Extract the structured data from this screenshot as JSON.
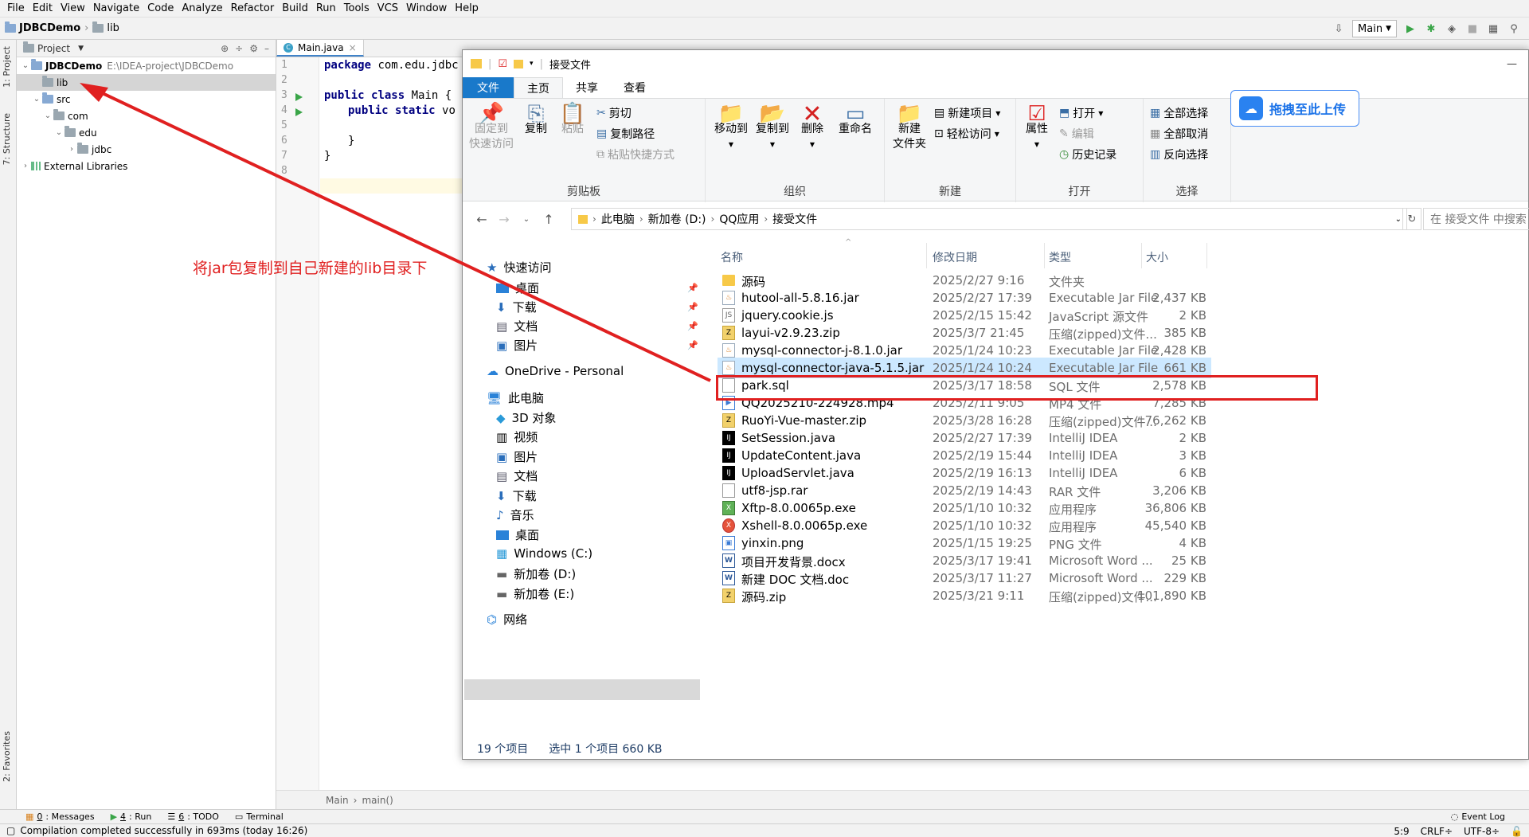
{
  "menu": [
    "File",
    "Edit",
    "View",
    "Navigate",
    "Code",
    "Analyze",
    "Refactor",
    "Build",
    "Run",
    "Tools",
    "VCS",
    "Window",
    "Help"
  ],
  "nav": {
    "project": "JDBCDemo",
    "folder": "lib",
    "run_config": "Main"
  },
  "left_strip": {
    "project": "1: Project",
    "structure": "7: Structure",
    "favorites": "2: Favorites"
  },
  "project_panel": {
    "title": "Project",
    "tree": [
      {
        "label": "JDBCDemo",
        "path": "E:\\IDEA-project\\JDBCDemo"
      },
      {
        "label": "lib"
      },
      {
        "label": "src"
      },
      {
        "label": "com"
      },
      {
        "label": "edu"
      },
      {
        "label": "jdbc"
      },
      {
        "label": "External Libraries"
      }
    ]
  },
  "editor": {
    "tab": "Main.java",
    "lines": [
      "1",
      "2",
      "3",
      "4",
      "5",
      "6",
      "7",
      "8"
    ],
    "code": {
      "l1_kw": "package",
      "l1_rest": " com.edu.jdbc",
      "l3_kw1": "public",
      "l3_kw2": "class",
      "l3_rest": " Main {",
      "l4_kw1": "public",
      "l4_kw2": "static",
      "l4_rest": " vo",
      "l6": "}",
      "l7": "}"
    },
    "crumb_main": "Main",
    "crumb_method": "main()"
  },
  "bottom_tools": [
    {
      "num": "0",
      "label": ": Messages"
    },
    {
      "num": "4",
      "label": ": Run"
    },
    {
      "num": "6",
      "label": ": TODO"
    },
    {
      "num": "",
      "label": "Terminal"
    }
  ],
  "event_log": "Event Log",
  "status": {
    "message": "Compilation completed successfully in 693ms (today 16:26)",
    "position": "5:9",
    "line_sep": "CRLF÷",
    "encoding": "UTF-8÷"
  },
  "explorer": {
    "title": "接受文件",
    "tabs": {
      "file": "文件",
      "home": "主页",
      "share": "共享",
      "view": "查看"
    },
    "ribbon": {
      "pin": "固定到\n快速访问",
      "copy": "复制",
      "paste": "粘贴",
      "cut": "剪切",
      "copy_path": "复制路径",
      "paste_shortcut": "粘贴快捷方式",
      "grp_clipboard": "剪贴板",
      "move_to": "移动到",
      "copy_to": "复制到",
      "delete": "删除",
      "rename": "重命名",
      "grp_organize": "组织",
      "new_folder": "新建\n文件夹",
      "new_item": "新建项目",
      "easy_access": "轻松访问",
      "grp_new": "新建",
      "properties": "属性",
      "open": "打开",
      "edit": "编辑",
      "history": "历史记录",
      "grp_open": "打开",
      "select_all": "全部选择",
      "select_none": "全部取消",
      "invert": "反向选择",
      "grp_select": "选择"
    },
    "upload_label": "拖拽至此上传",
    "address": [
      "此电脑",
      "新加卷 (D:)",
      "QQ应用",
      "接受文件"
    ],
    "search_placeholder": "在 接受文件 中搜索",
    "nav_pane": {
      "quick_access": "快速访问",
      "qa_items": [
        "桌面",
        "下载",
        "文档",
        "图片"
      ],
      "onedrive": "OneDrive - Personal",
      "this_pc": "此电脑",
      "pc_items": [
        "3D 对象",
        "视频",
        "图片",
        "文档",
        "下载",
        "音乐",
        "桌面",
        "Windows (C:)",
        "新加卷 (D:)",
        "新加卷 (E:)"
      ],
      "network": "网络"
    },
    "columns": {
      "name": "名称",
      "date": "修改日期",
      "type": "类型",
      "size": "大小"
    },
    "files": [
      {
        "name": "源码",
        "date": "2025/2/27 9:16",
        "type": "文件夹",
        "size": "",
        "icon": "folder"
      },
      {
        "name": "hutool-all-5.8.16.jar",
        "date": "2025/2/27 17:39",
        "type": "Executable Jar File",
        "size": "2,437 KB",
        "icon": "jar"
      },
      {
        "name": "jquery.cookie.js",
        "date": "2025/2/15 15:42",
        "type": "JavaScript 源文件",
        "size": "2 KB",
        "icon": "js"
      },
      {
        "name": "layui-v2.9.23.zip",
        "date": "2025/3/7 21:45",
        "type": "压缩(zipped)文件...",
        "size": "385 KB",
        "icon": "zip"
      },
      {
        "name": "mysql-connector-j-8.1.0.jar",
        "date": "2025/1/24 10:23",
        "type": "Executable Jar File",
        "size": "2,428 KB",
        "icon": "jar"
      },
      {
        "name": "mysql-connector-java-5.1.5.jar",
        "date": "2025/1/24 10:24",
        "type": "Executable Jar File",
        "size": "661 KB",
        "icon": "jar"
      },
      {
        "name": "park.sql",
        "date": "2025/3/17 18:58",
        "type": "SQL 文件",
        "size": "2,578 KB",
        "icon": "sql"
      },
      {
        "name": "QQ2025210-224928.mp4",
        "date": "2025/2/11 9:05",
        "type": "MP4 文件",
        "size": "7,285 KB",
        "icon": "vid"
      },
      {
        "name": "RuoYi-Vue-master.zip",
        "date": "2025/3/28 16:28",
        "type": "压缩(zipped)文件...",
        "size": "76,262 KB",
        "icon": "zip"
      },
      {
        "name": "SetSession.java",
        "date": "2025/2/27 17:39",
        "type": "IntelliJ IDEA",
        "size": "2 KB",
        "icon": "idea"
      },
      {
        "name": "UpdateContent.java",
        "date": "2025/2/19 15:44",
        "type": "IntelliJ IDEA",
        "size": "3 KB",
        "icon": "idea"
      },
      {
        "name": "UploadServlet.java",
        "date": "2025/2/19 16:13",
        "type": "IntelliJ IDEA",
        "size": "6 KB",
        "icon": "idea"
      },
      {
        "name": "utf8-jsp.rar",
        "date": "2025/2/19 14:43",
        "type": "RAR 文件",
        "size": "3,206 KB",
        "icon": "rar"
      },
      {
        "name": "Xftp-8.0.0065p.exe",
        "date": "2025/1/10 10:32",
        "type": "应用程序",
        "size": "36,806 KB",
        "icon": "exe1"
      },
      {
        "name": "Xshell-8.0.0065p.exe",
        "date": "2025/1/10 10:32",
        "type": "应用程序",
        "size": "45,540 KB",
        "icon": "exe2"
      },
      {
        "name": "yinxin.png",
        "date": "2025/1/15 19:25",
        "type": "PNG 文件",
        "size": "4 KB",
        "icon": "img"
      },
      {
        "name": "项目开发背景.docx",
        "date": "2025/3/17 19:41",
        "type": "Microsoft Word ...",
        "size": "25 KB",
        "icon": "doc"
      },
      {
        "name": "新建 DOC 文档.doc",
        "date": "2025/3/17 11:27",
        "type": "Microsoft Word ...",
        "size": "229 KB",
        "icon": "doc"
      },
      {
        "name": "源码.zip",
        "date": "2025/3/21 9:11",
        "type": "压缩(zipped)文件...",
        "size": "101,890 KB",
        "icon": "zip"
      }
    ],
    "status_count": "19 个项目",
    "status_selected": "选中 1 个项目  660 KB"
  },
  "annotation": "将jar包复制到自己新建的lib目录下",
  "colors": {
    "annotation": "#e02020",
    "file_tab": "#1979ca",
    "selection": "#cce8ff"
  }
}
